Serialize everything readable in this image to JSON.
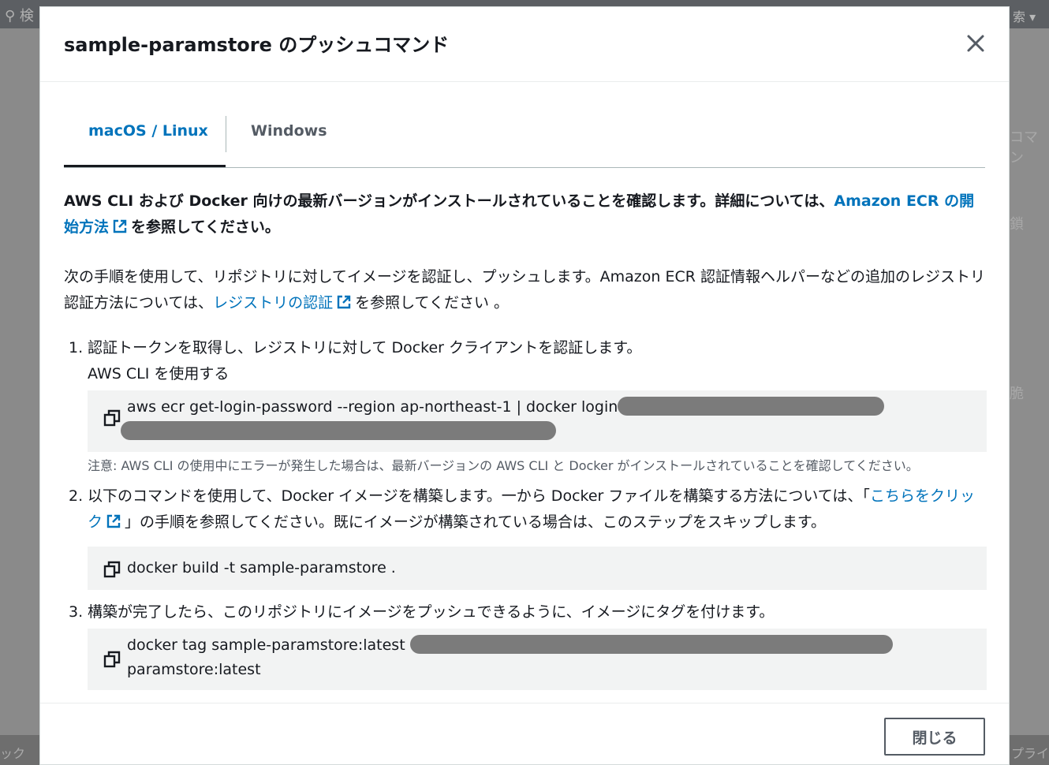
{
  "background": {
    "search_glyph": "⚲ 検",
    "top_right": "索 ▾",
    "right_labels": [
      "コマン",
      "鎖",
      "脆"
    ],
    "bottom_left": "ック",
    "bottom_right": "プライ"
  },
  "modal": {
    "title": "sample-paramstore のプッシュコマンド",
    "close_icon": "close-icon",
    "tabs": [
      {
        "label": "macOS / Linux",
        "active": true
      },
      {
        "label": "Windows",
        "active": false
      }
    ],
    "intro": {
      "text_before_link": "AWS CLI および Docker 向けの最新バージョンがインストールされていることを確認します。詳細については、",
      "link_text": "Amazon ECR の開始方法",
      "text_after_link": "を参照してください。"
    },
    "paragraph": {
      "text_before_link": "次の手順を使用して、リポジトリに対してイメージを認証し、プッシュします。Amazon ECR 認証情報ヘルパーなどの追加のレジストリ認証方法については、",
      "link_text": "レジストリの認証",
      "text_after_link": "を参照してください 。"
    },
    "steps": [
      {
        "number": "1.",
        "text": "認証トークンを取得し、レジストリに対して Docker クライアントを認証します。",
        "sub_label": "AWS CLI を使用する",
        "command": "aws ecr get-login-password --region ap-northeast-1 | docker login",
        "note": "注意: AWS CLI の使用中にエラーが発生した場合は、最新バージョンの AWS CLI と Docker がインストールされていることを確認してください。"
      },
      {
        "number": "2.",
        "text_before_link": "以下のコマンドを使用して、Docker イメージを構築します。一から Docker ファイルを構築する方法については、「",
        "link_text": "こちらをクリック",
        "text_after_link": "」の手順を参照してください。既にイメージが構築されている場合は、このステップをスキップします。",
        "command": "docker build -t sample-paramstore ."
      },
      {
        "number": "3.",
        "text": "構築が完了したら、このリポジトリにイメージをプッシュできるように、イメージにタグを付けます。",
        "command": "docker tag sample-paramstore:latest",
        "command_cont": "paramstore:latest"
      }
    ],
    "footer": {
      "close_button": "閉じる"
    }
  },
  "colors": {
    "link": "#0073bb",
    "text": "#16191f",
    "code_bg": "#f2f3f3",
    "redaction": "#7b7b7b"
  }
}
